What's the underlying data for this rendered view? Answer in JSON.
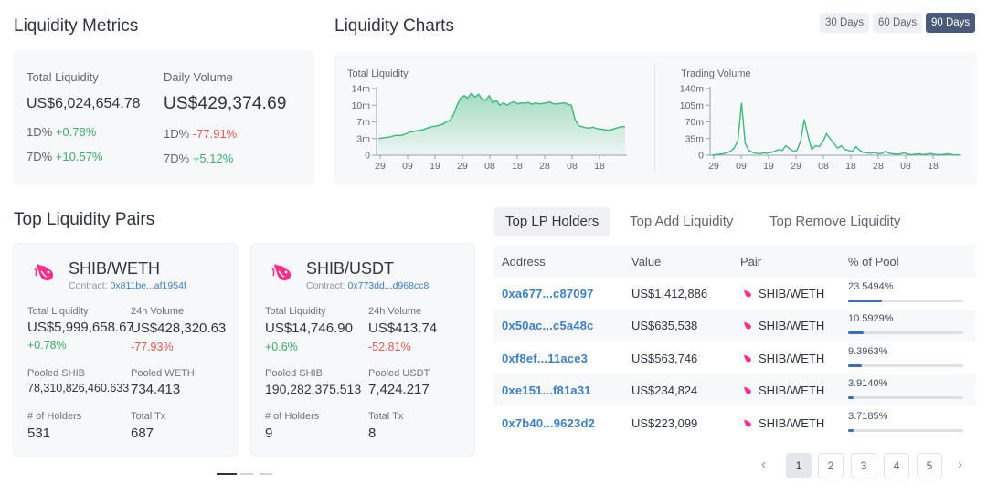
{
  "metrics": {
    "title": "Liquidity Metrics",
    "total_liquidity": {
      "label": "Total Liquidity",
      "value": "US$6,024,654.78",
      "d1_label": "1D%",
      "d1": "+0.78%",
      "d7_label": "7D%",
      "d7": "+10.57%"
    },
    "daily_volume": {
      "label": "Daily Volume",
      "value": "US$429,374.69",
      "d1_label": "1D%",
      "d1": "-77.91%",
      "d7_label": "7D%",
      "d7": "+5.12%"
    }
  },
  "charts": {
    "title": "Liquidity Charts",
    "ranges": [
      "30 Days",
      "60 Days",
      "90 Days"
    ],
    "active_range": "90 Days"
  },
  "chart_data": [
    {
      "type": "area",
      "title": "Total Liquidity",
      "y_ticks": [
        "0",
        "3m",
        "7m",
        "10m",
        "14m"
      ],
      "ylim": [
        0,
        14
      ],
      "x_ticks": [
        "29",
        "09",
        "19",
        "29",
        "08",
        "18",
        "28",
        "08",
        "18"
      ],
      "values": [
        3.5,
        3.6,
        3.7,
        3.8,
        4.0,
        4.2,
        4.1,
        4.3,
        4.6,
        4.9,
        5.0,
        5.2,
        5.3,
        5.5,
        5.8,
        6.0,
        6.1,
        6.3,
        6.5,
        7.0,
        7.3,
        8.5,
        10.5,
        12.0,
        12.5,
        12.0,
        13.0,
        12.2,
        12.8,
        11.8,
        11.5,
        12.5,
        11.0,
        11.5,
        10.5,
        11.0,
        10.5,
        11.0,
        11.2,
        10.8,
        11.0,
        10.9,
        11.1,
        10.7,
        11.0,
        10.8,
        10.9,
        11.0,
        11.2,
        10.8,
        10.8,
        10.9,
        11.0,
        10.7,
        10.5,
        7.5,
        6.2,
        6.0,
        5.8,
        5.7,
        5.9,
        5.6,
        5.5,
        5.4,
        5.3,
        5.3,
        5.6,
        5.8,
        6.0,
        6.0
      ],
      "color": "#3cb878"
    },
    {
      "type": "line",
      "title": "Trading Volume",
      "y_ticks": [
        "0",
        "35m",
        "70m",
        "105m",
        "140m"
      ],
      "ylim": [
        0,
        140
      ],
      "x_ticks": [
        "29",
        "09",
        "19",
        "29",
        "08",
        "18",
        "28",
        "08",
        "18"
      ],
      "values": [
        0,
        1,
        2,
        3,
        5,
        8,
        15,
        30,
        110,
        25,
        10,
        6,
        4,
        3,
        5,
        4,
        6,
        8,
        12,
        10,
        20,
        14,
        8,
        10,
        30,
        75,
        40,
        12,
        20,
        18,
        28,
        45,
        35,
        25,
        15,
        20,
        12,
        10,
        8,
        18,
        10,
        6,
        5,
        4,
        6,
        3,
        4,
        8,
        4,
        3,
        2,
        3,
        5,
        2,
        1,
        2,
        3,
        1,
        2,
        4,
        2,
        1,
        1,
        2,
        3,
        1,
        0.5,
        0.5
      ],
      "color": "#3cb878"
    }
  ],
  "pairs": {
    "title": "Top Liquidity Pairs",
    "cards": [
      {
        "name": "SHIB/WETH",
        "contract_label": "Contract:",
        "contract": "0x811be...af1954f",
        "tl_label": "Total Liquidity",
        "tl": "US$5,999,658.67",
        "tl_chg": "+0.78%",
        "vol_label": "24h Volume",
        "vol": "US$428,320.63",
        "vol_chg": "-77.93%",
        "pooled_a_label": "Pooled SHIB",
        "pooled_a": "78,310,826,460.633",
        "pooled_b_label": "Pooled WETH",
        "pooled_b": "734.413",
        "holders_label": "# of Holders",
        "holders": "531",
        "tx_label": "Total Tx",
        "tx": "687"
      },
      {
        "name": "SHIB/USDT",
        "contract_label": "Contract:",
        "contract": "0x773dd...d968cc8",
        "tl_label": "Total Liquidity",
        "tl": "US$14,746.90",
        "tl_chg": "+0.6%",
        "vol_label": "24h Volume",
        "vol": "US$413.74",
        "vol_chg": "-52.81%",
        "pooled_a_label": "Pooled SHIB",
        "pooled_a": "190,282,375.513",
        "pooled_b_label": "Pooled USDT",
        "pooled_b": "7,424.217",
        "holders_label": "# of Holders",
        "holders": "9",
        "tx_label": "Total Tx",
        "tx": "8"
      }
    ]
  },
  "tabs": [
    "Top LP Holders",
    "Top Add Liquidity",
    "Top Remove Liquidity"
  ],
  "table": {
    "headers": [
      "Address",
      "Value",
      "Pair",
      "% of Pool"
    ],
    "rows": [
      {
        "address": "0xa677...c87097",
        "value": "US$1,412,886",
        "pair": "SHIB/WETH",
        "pct": "23.5494%",
        "frac": 0.235494
      },
      {
        "address": "0x50ac...c5a48c",
        "value": "US$635,538",
        "pair": "SHIB/WETH",
        "pct": "10.5929%",
        "frac": 0.105929
      },
      {
        "address": "0xf8ef...11ace3",
        "value": "US$563,746",
        "pair": "SHIB/WETH",
        "pct": "9.3963%",
        "frac": 0.093963
      },
      {
        "address": "0xe151...f81a31",
        "value": "US$234,824",
        "pair": "SHIB/WETH",
        "pct": "3.9140%",
        "frac": 0.03914
      },
      {
        "address": "0x7b40...9623d2",
        "value": "US$223,099",
        "pair": "SHIB/WETH",
        "pct": "3.7185%",
        "frac": 0.037185
      }
    ]
  },
  "pagination": {
    "pages": [
      "1",
      "2",
      "3",
      "4",
      "5"
    ],
    "current": "1"
  }
}
